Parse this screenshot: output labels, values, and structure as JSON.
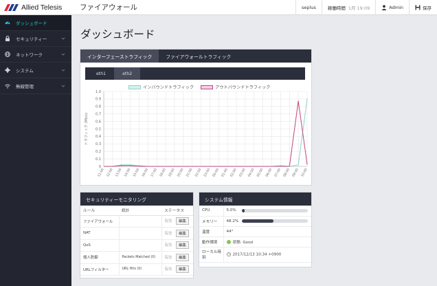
{
  "header": {
    "brand": "Allied Telesis",
    "app_title": "ファイアウォール",
    "hostname": "seplus",
    "uptime_label": "稼働時間",
    "uptime_value": "1月 19:09",
    "user": "Admin",
    "save": "保存",
    "brand_colors": {
      "red": "#e6243a",
      "blue": "#1a3f8f"
    }
  },
  "sidebar": {
    "items": [
      {
        "label": "ダッシュボード",
        "icon": "dashboard-icon",
        "active": true
      },
      {
        "label": "セキュリティー",
        "icon": "lock-icon"
      },
      {
        "label": "ネットワーク",
        "icon": "globe-icon"
      },
      {
        "label": "システム",
        "icon": "gear-icon"
      },
      {
        "label": "無線管理",
        "icon": "wifi-icon"
      }
    ]
  },
  "page": {
    "title": "ダッシュボード"
  },
  "traffic": {
    "tabs": [
      "インターフェーストラフィック",
      "ファイアウォールトラフィック"
    ],
    "subtabs": [
      "eth1",
      "eth2"
    ],
    "legend": [
      "インバウンドトラフィック",
      "アウトバウンドトラフィック"
    ]
  },
  "chart_data": {
    "type": "line",
    "ylabel": "トラフィック (Mb/s)",
    "ylim": [
      0,
      1.0
    ],
    "yticks": [
      "0",
      "0.1",
      "0.2",
      "0.3",
      "0.4",
      "0.5",
      "0.6",
      "0.7",
      "0.8",
      "0.9",
      "1.0"
    ],
    "x": [
      "11:00",
      "12:00",
      "13:00",
      "14:00",
      "15:00",
      "16:00",
      "17:00",
      "18:00",
      "19:00",
      "20:00",
      "21:00",
      "22:00",
      "23:00",
      "00:00",
      "01:00",
      "02:00",
      "03:00",
      "04:00",
      "05:00",
      "06:00",
      "07:00",
      "08:00",
      "09:00",
      "10:00"
    ],
    "grid": true,
    "legend_position": "top",
    "series": [
      {
        "name": "インバウンドトラフィック",
        "color": "#8fd3c8",
        "values": [
          0,
          0,
          0.02,
          0.02,
          0.01,
          0,
          0,
          0,
          0,
          0,
          0,
          0,
          0,
          0,
          0,
          0,
          0,
          0,
          0,
          0,
          0.01,
          0,
          0.02,
          0.9
        ]
      },
      {
        "name": "アウトバウンドトラフィック",
        "color": "#c2447e",
        "values": [
          0,
          0,
          0.01,
          0.01,
          0,
          0,
          0,
          0,
          0,
          0,
          0,
          0,
          0,
          0,
          0,
          0,
          0,
          0,
          0,
          0,
          0,
          0,
          0.87,
          0.03
        ]
      }
    ]
  },
  "security": {
    "title": "セキュリティーモニタリング",
    "columns": [
      "ルール",
      "統計",
      "ステータス"
    ],
    "rows": [
      {
        "rule": "ファイアウォール",
        "stat": "",
        "status": "有効",
        "btn": "編集"
      },
      {
        "rule": "NAT",
        "stat": "",
        "status": "有効",
        "btn": "編集"
      },
      {
        "rule": "QoS",
        "stat": "",
        "status": "有効",
        "btn": "編集"
      },
      {
        "rule": "侵入防御",
        "stat": "Packets Matched (0)",
        "status": "有効",
        "btn": "編集"
      },
      {
        "rule": "URLフィルター",
        "stat": "URL Hits (0)",
        "status": "有効",
        "btn": "編集"
      }
    ]
  },
  "system": {
    "title": "システム情報",
    "cpu_label": "CPU",
    "cpu_value": "5.0%",
    "cpu_pct": 5.0,
    "mem_label": "メモリー",
    "mem_value": "48.2%",
    "mem_pct": 48.2,
    "temp_label": "温度",
    "temp_value": "44°",
    "state_label": "動作環境",
    "state_value": "状態: Good",
    "time_label": "ローカル時刻",
    "time_value": "2017/12/13 10:34 +0900",
    "good_color": "#8bc34a"
  }
}
